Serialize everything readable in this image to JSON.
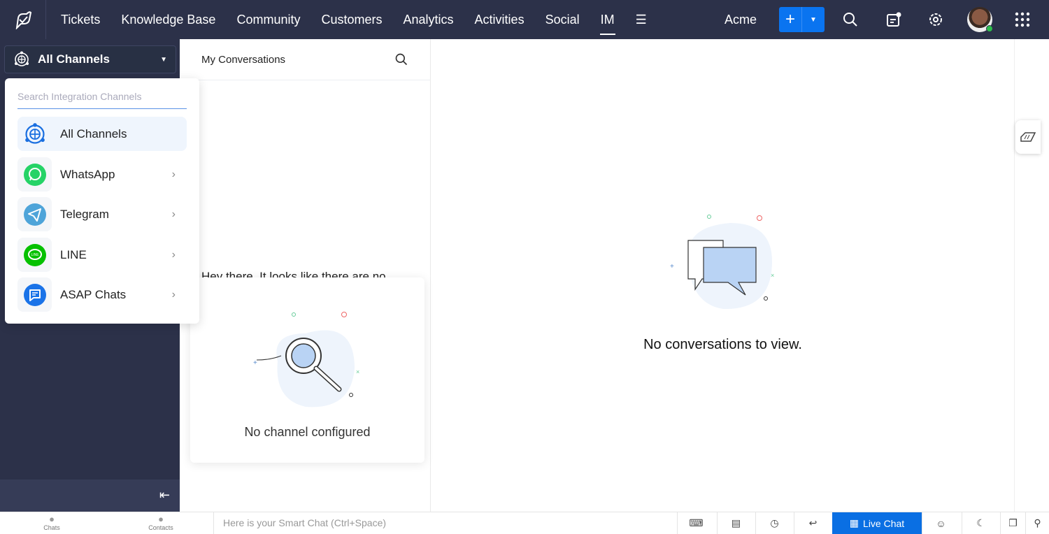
{
  "topbar": {
    "nav": [
      "Tickets",
      "Knowledge Base",
      "Community",
      "Customers",
      "Analytics",
      "Activities",
      "Social",
      "IM"
    ],
    "active": "IM",
    "org": "Acme",
    "add_label": "+"
  },
  "sidebar": {
    "channel_selector": "All Channels"
  },
  "dropdown": {
    "search_placeholder": "Search Integration Channels",
    "items": [
      {
        "label": "All Channels",
        "icon": "globe-icon",
        "selected": true
      },
      {
        "label": "WhatsApp",
        "icon": "whatsapp-icon",
        "color": "#25d366"
      },
      {
        "label": "Telegram",
        "icon": "telegram-icon",
        "color": "#4ea4d9"
      },
      {
        "label": "LINE",
        "icon": "line-icon",
        "color": "#06c100"
      },
      {
        "label": "ASAP Chats",
        "icon": "chat-icon",
        "color": "#1a73e8"
      }
    ]
  },
  "conversations": {
    "title": "My Conversations",
    "hint": "Hey there, It looks like there are no",
    "card_text": "No channel configured"
  },
  "main": {
    "empty_text": "No conversations to view."
  },
  "bottom": {
    "chats": "Chats",
    "contacts": "Contacts",
    "smart_chat_placeholder": "Here is your Smart Chat (Ctrl+Space)",
    "live_chat": "Live Chat"
  },
  "colors": {
    "topbar": "#2c3149",
    "accent": "#0a74f0"
  }
}
